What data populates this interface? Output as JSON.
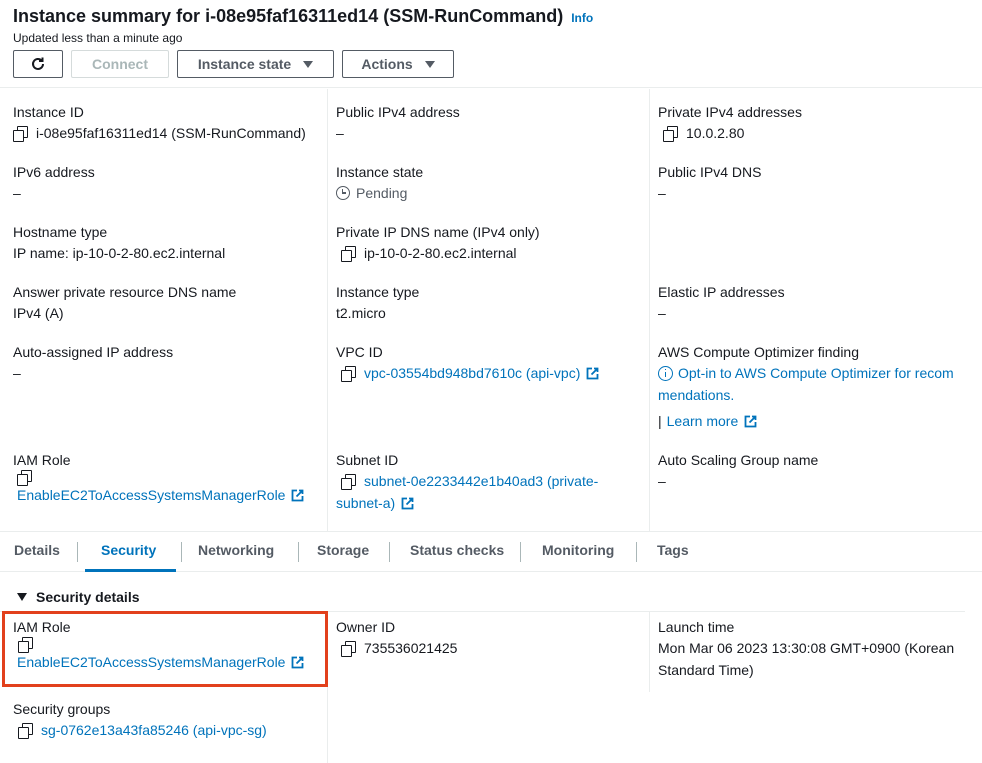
{
  "header": {
    "title": "Instance summary for i-08e95faf16311ed14 (SSM-RunCommand)",
    "info": "Info",
    "updated": "Updated less than a minute ago",
    "buttons": {
      "connect": "Connect",
      "instance_state": "Instance state",
      "actions": "Actions"
    }
  },
  "summary": {
    "instance_id": {
      "label": "Instance ID",
      "value": "i-08e95faf16311ed14 (SSM-RunCommand)"
    },
    "public_ipv4": {
      "label": "Public IPv4 address",
      "value": "–"
    },
    "private_ipv4": {
      "label": "Private IPv4 addresses",
      "value": "10.0.2.80"
    },
    "ipv6": {
      "label": "IPv6 address",
      "value": "–"
    },
    "instance_state": {
      "label": "Instance state",
      "value": "Pending"
    },
    "public_dns": {
      "label": "Public IPv4 DNS",
      "value": "–"
    },
    "hostname_type": {
      "label": "Hostname type",
      "value": "IP name: ip-10-0-2-80.ec2.internal"
    },
    "private_dns": {
      "label": "Private IP DNS name (IPv4 only)",
      "value": "ip-10-0-2-80.ec2.internal"
    },
    "answer_dns": {
      "label": "Answer private resource DNS name",
      "value": "IPv4 (A)"
    },
    "instance_type": {
      "label": "Instance type",
      "value": "t2.micro"
    },
    "elastic_ip": {
      "label": "Elastic IP addresses",
      "value": "–"
    },
    "auto_ip": {
      "label": "Auto-assigned IP address",
      "value": "–"
    },
    "vpc_id": {
      "label": "VPC ID",
      "value": "vpc-03554bd948bd7610c (api-vpc)"
    },
    "optimizer": {
      "label": "AWS Compute Optimizer finding",
      "line1": "Opt-in to AWS Compute Optimizer for recom",
      "line2": "mendations.",
      "learn_more": "Learn more"
    },
    "iam_role": {
      "label": "IAM Role",
      "value": "EnableEC2ToAccessSystemsManagerRole"
    },
    "subnet_id": {
      "label": "Subnet ID",
      "line1": "subnet-0e2233442e1b40ad3 (private-",
      "line2": "subnet-a)"
    },
    "asg": {
      "label": "Auto Scaling Group name",
      "value": "–"
    }
  },
  "tabs": [
    "Details",
    "Security",
    "Networking",
    "Storage",
    "Status checks",
    "Monitoring",
    "Tags"
  ],
  "security": {
    "section_title": "Security details",
    "iam_role": {
      "label": "IAM Role",
      "value": "EnableEC2ToAccessSystemsManagerRole"
    },
    "owner_id": {
      "label": "Owner ID",
      "value": "735536021425"
    },
    "launch_time": {
      "label": "Launch time",
      "line1": "Mon Mar 06 2023 13:30:08 GMT+0900 (Korean",
      "line2": "Standard Time)"
    },
    "security_groups": {
      "label": "Security groups",
      "value": "sg-0762e13a43fa85246 (api-vpc-sg)"
    }
  },
  "colors": {
    "link": "#0073bb",
    "highlight": "#e2401c",
    "active_tab": "#0073bb"
  }
}
